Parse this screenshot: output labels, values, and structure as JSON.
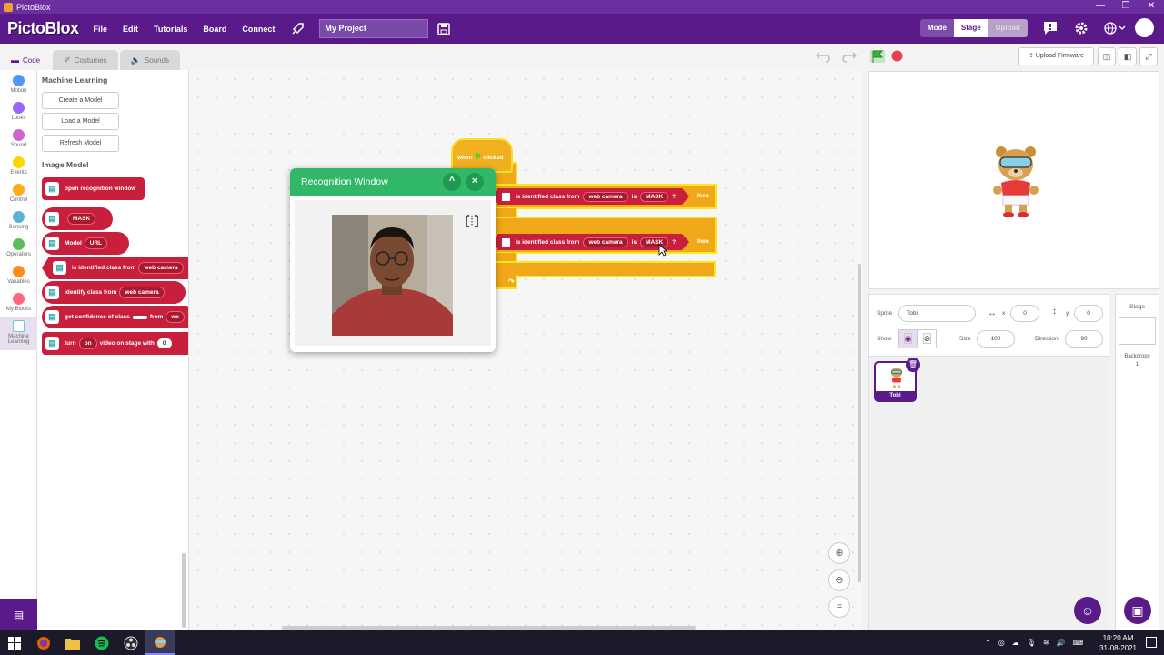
{
  "window": {
    "title": "PictoBlox",
    "min": "—",
    "max": "❒",
    "close": "✕"
  },
  "menubar": {
    "logo": "PictoBlox",
    "items": [
      "File",
      "Edit",
      "Tutorials",
      "Board",
      "Connect"
    ],
    "project_name": "My Project",
    "mode_label": "Mode",
    "mode_stage": "Stage",
    "mode_upload": "Upload"
  },
  "tabs": [
    {
      "label": "Code",
      "active": true
    },
    {
      "label": "Costumes",
      "active": false
    },
    {
      "label": "Sounds",
      "active": false
    }
  ],
  "categories": [
    {
      "label": "Motion",
      "color": "#4c97ff"
    },
    {
      "label": "Looks",
      "color": "#9966ff"
    },
    {
      "label": "Sound",
      "color": "#cf63cf"
    },
    {
      "label": "Events",
      "color": "#ffd500"
    },
    {
      "label": "Control",
      "color": "#ffab19"
    },
    {
      "label": "Sensing",
      "color": "#5cb1d6"
    },
    {
      "label": "Operators",
      "color": "#59c059"
    },
    {
      "label": "Variables",
      "color": "#ff8c1a"
    },
    {
      "label": "My Blocks",
      "color": "#ff6680"
    },
    {
      "label": "Machine Learning",
      "color": "#ffffff"
    }
  ],
  "palette": {
    "section1": "Machine Learning",
    "buttons": [
      "Create a Model",
      "Load a Model",
      "Refresh Model"
    ],
    "section2": "Image Model",
    "blocks": {
      "open_window": "open recognition window",
      "mask_dd": "MASK",
      "model_label": "Model",
      "model_dd": "URL",
      "is_identified": "is identified class from",
      "is_identified_dd": "web camera",
      "identify": "identify class from",
      "identify_dd": "web camera",
      "confidence": "get confidence of class",
      "confidence_from": "from",
      "confidence_dd": "we",
      "turn": "turn",
      "turn_dd": "on",
      "turn_rest": "video on stage with",
      "turn_val": "0"
    }
  },
  "script": {
    "hat_when": "when",
    "hat_clicked": "clicked",
    "if_then": "then",
    "cond_text": "is identified class from",
    "cond_dd": "web camera",
    "cond_is": "is",
    "cond_class": "MASK",
    "cond_q": "?"
  },
  "recognition_window": {
    "title": "Recognition Window",
    "minimize": "^",
    "close": "×"
  },
  "stage_toolbar": {
    "upload_firmware": "Upload Firmware"
  },
  "sprite_info": {
    "sprite_label": "Sprite",
    "sprite_name": "Tobi",
    "x_label": "x",
    "x": "0",
    "y_label": "y",
    "y": "0",
    "show_label": "Show",
    "size_label": "Size",
    "size": "100",
    "direction_label": "Direction",
    "direction": "90"
  },
  "sprites": [
    {
      "name": "Tobi",
      "selected": true
    }
  ],
  "stage_panel": {
    "title": "Stage",
    "backdrops_label": "Backdrops",
    "backdrops_count": "1"
  },
  "taskbar": {
    "time": "10:20 AM",
    "date": "31-08-2021"
  },
  "colors": {
    "brand": "#5b1a8a",
    "block_red": "#c8203c",
    "control_orange": "#f0a818",
    "rec_green": "#30b868"
  }
}
